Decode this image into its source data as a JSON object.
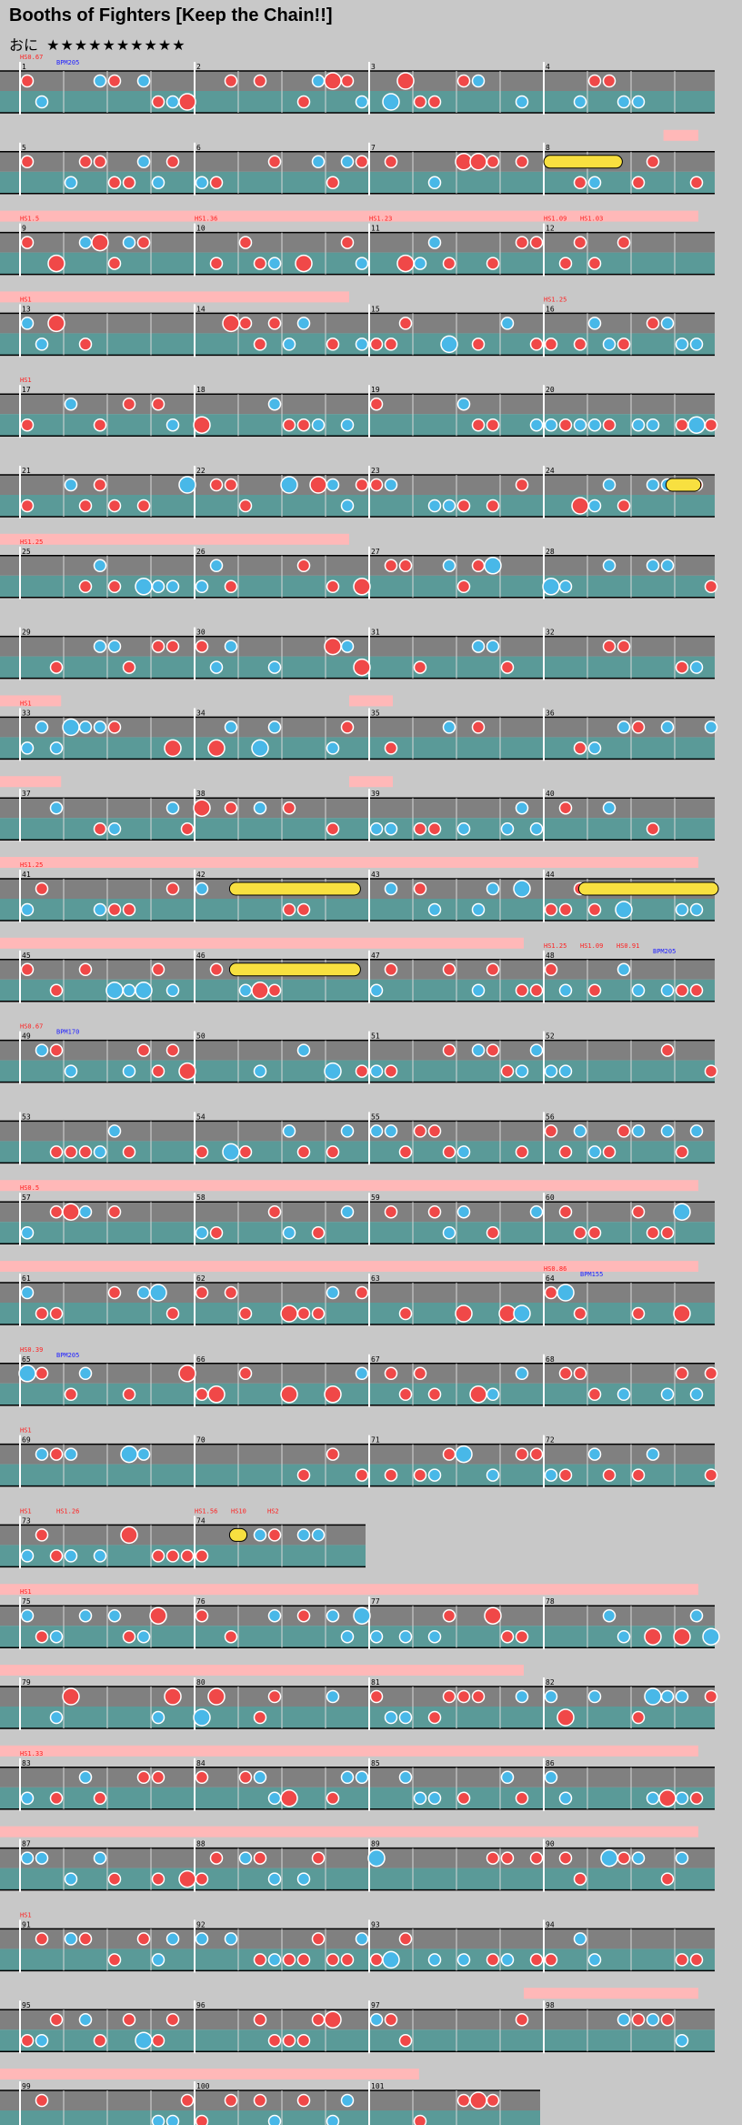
{
  "song": {
    "title": "Booths of Fighters [Keep the Chain!!]",
    "difficulty_label": "おに",
    "stars": "★★★★★★★★★★"
  },
  "colors": {
    "background": "#c8c8c8",
    "lane_top": "#808080",
    "lane_bottom": "#5a9a98",
    "don": "#f04848",
    "ka": "#48b8e8",
    "roll": "#f8e040",
    "hs_text": "#ff2020",
    "bpm_text": "#2020ff",
    "gogo": "#ffb8b8"
  },
  "chart_data": {
    "type": "rows",
    "measures_per_row": 4,
    "rows": [
      {
        "measures": [
          1,
          2,
          3,
          4
        ],
        "labels": [
          {
            "m": 1,
            "t": "HS0.67"
          },
          {
            "m": 1,
            "t": "BPM205",
            "c": "bpm"
          }
        ],
        "gogo": []
      },
      {
        "measures": [
          5,
          6,
          7,
          8
        ],
        "labels": [],
        "gogo": [
          [
            3.8,
            4.0
          ]
        ],
        "roll": [
          [
            3.0,
            3.45
          ]
        ]
      },
      {
        "measures": [
          9,
          10,
          11,
          12
        ],
        "labels": [
          {
            "m": 9,
            "t": "HS1.5"
          },
          {
            "m": 10,
            "t": "HS1.36"
          },
          {
            "m": 11,
            "t": "HS1.23"
          },
          {
            "m": 12,
            "t": "HS1.09"
          },
          {
            "m": 12,
            "t": "HS1.03"
          }
        ],
        "gogo": [
          [
            0,
            4
          ]
        ]
      },
      {
        "measures": [
          13,
          14,
          15,
          16
        ],
        "labels": [
          {
            "m": 13,
            "t": "HS1"
          },
          {
            "m": 16,
            "t": "HS1.25"
          }
        ],
        "gogo": [
          [
            0,
            2
          ]
        ]
      },
      {
        "measures": [
          17,
          18,
          19,
          20
        ],
        "labels": [
          {
            "m": 17,
            "t": "HS1"
          }
        ],
        "gogo": []
      },
      {
        "measures": [
          21,
          22,
          23,
          24
        ],
        "labels": [],
        "gogo": [],
        "roll": [
          [
            3.7,
            3.9
          ]
        ]
      },
      {
        "measures": [
          25,
          26,
          27,
          28
        ],
        "labels": [
          {
            "m": 25,
            "t": "HS1.25"
          }
        ],
        "gogo": [
          [
            0,
            2
          ]
        ]
      },
      {
        "measures": [
          29,
          30,
          31,
          32
        ],
        "labels": [],
        "gogo": []
      },
      {
        "measures": [
          33,
          34,
          35,
          36
        ],
        "labels": [
          {
            "m": 33,
            "t": "HS1"
          }
        ],
        "gogo": [
          [
            0,
            0.35
          ],
          [
            2.0,
            2.25
          ]
        ]
      },
      {
        "measures": [
          37,
          38,
          39,
          40
        ],
        "labels": [],
        "gogo": [
          [
            0,
            0.35
          ],
          [
            2.0,
            2.25
          ]
        ]
      },
      {
        "measures": [
          41,
          42,
          43,
          44
        ],
        "labels": [
          {
            "m": 41,
            "t": "HS1.25"
          }
        ],
        "gogo": [
          [
            0,
            4
          ]
        ],
        "roll": [
          [
            1.2,
            1.95
          ],
          [
            3.2,
            4.0
          ]
        ]
      },
      {
        "measures": [
          45,
          46,
          47,
          48
        ],
        "labels": [
          {
            "m": 48,
            "t": "HS1.25"
          },
          {
            "m": 48,
            "t": "HS1.09"
          },
          {
            "m": 48,
            "t": "HS0.91"
          },
          {
            "m": 48,
            "t": "BPM205",
            "c": "bpm"
          }
        ],
        "gogo": [
          [
            0,
            3
          ]
        ],
        "roll": [
          [
            1.2,
            1.95
          ]
        ]
      },
      {
        "measures": [
          49,
          50,
          51,
          52
        ],
        "labels": [
          {
            "m": 49,
            "t": "HS0.67"
          },
          {
            "m": 49,
            "t": "BPM170",
            "c": "bpm"
          }
        ],
        "gogo": []
      },
      {
        "measures": [
          53,
          54,
          55,
          56
        ],
        "labels": [],
        "gogo": []
      },
      {
        "measures": [
          57,
          58,
          59,
          60
        ],
        "labels": [
          {
            "m": 57,
            "t": "HS0.5"
          }
        ],
        "gogo": [
          [
            0,
            4
          ]
        ]
      },
      {
        "measures": [
          61,
          62,
          63,
          64
        ],
        "labels": [
          {
            "m": 64,
            "t": "HS0.86"
          },
          {
            "m": 64,
            "t": "BPM155",
            "c": "bpm"
          }
        ],
        "gogo": [
          [
            0,
            4
          ]
        ]
      },
      {
        "measures": [
          65,
          66,
          67,
          68
        ],
        "labels": [
          {
            "m": 65,
            "t": "HS0.39"
          },
          {
            "m": 65,
            "t": "BPM205",
            "c": "bpm"
          }
        ],
        "gogo": []
      },
      {
        "measures": [
          69,
          70,
          71,
          72
        ],
        "labels": [
          {
            "m": 69,
            "t": "HS1"
          }
        ],
        "gogo": []
      },
      {
        "measures": [
          73,
          74
        ],
        "labels": [
          {
            "m": 73,
            "t": "HS1"
          },
          {
            "m": 73,
            "t": "HS1.26"
          },
          {
            "m": 74,
            "t": "HS1.56"
          },
          {
            "m": 74,
            "t": "HS10"
          },
          {
            "m": 74,
            "t": "HS2"
          }
        ],
        "gogo": [],
        "roll": [
          [
            1.2,
            1.3
          ]
        ]
      },
      {
        "measures": [
          75,
          76,
          77,
          78
        ],
        "labels": [
          {
            "m": 75,
            "t": "HS1"
          }
        ],
        "gogo": [
          [
            0,
            4
          ]
        ]
      },
      {
        "measures": [
          79,
          80,
          81,
          82
        ],
        "labels": [],
        "gogo": [
          [
            0,
            3
          ]
        ]
      },
      {
        "measures": [
          83,
          84,
          85,
          86
        ],
        "labels": [
          {
            "m": 83,
            "t": "HS1.33"
          }
        ],
        "gogo": [
          [
            0,
            4
          ]
        ]
      },
      {
        "measures": [
          87,
          88,
          89,
          90
        ],
        "labels": [],
        "gogo": [
          [
            0,
            4
          ]
        ]
      },
      {
        "measures": [
          91,
          92,
          93,
          94
        ],
        "labels": [
          {
            "m": 91,
            "t": "HS1"
          }
        ],
        "gogo": []
      },
      {
        "measures": [
          95,
          96,
          97,
          98
        ],
        "labels": [],
        "gogo": [
          [
            3,
            4
          ]
        ]
      },
      {
        "measures": [
          99,
          100,
          101
        ],
        "labels": [],
        "gogo": [
          [
            0,
            2.4
          ]
        ]
      }
    ]
  }
}
